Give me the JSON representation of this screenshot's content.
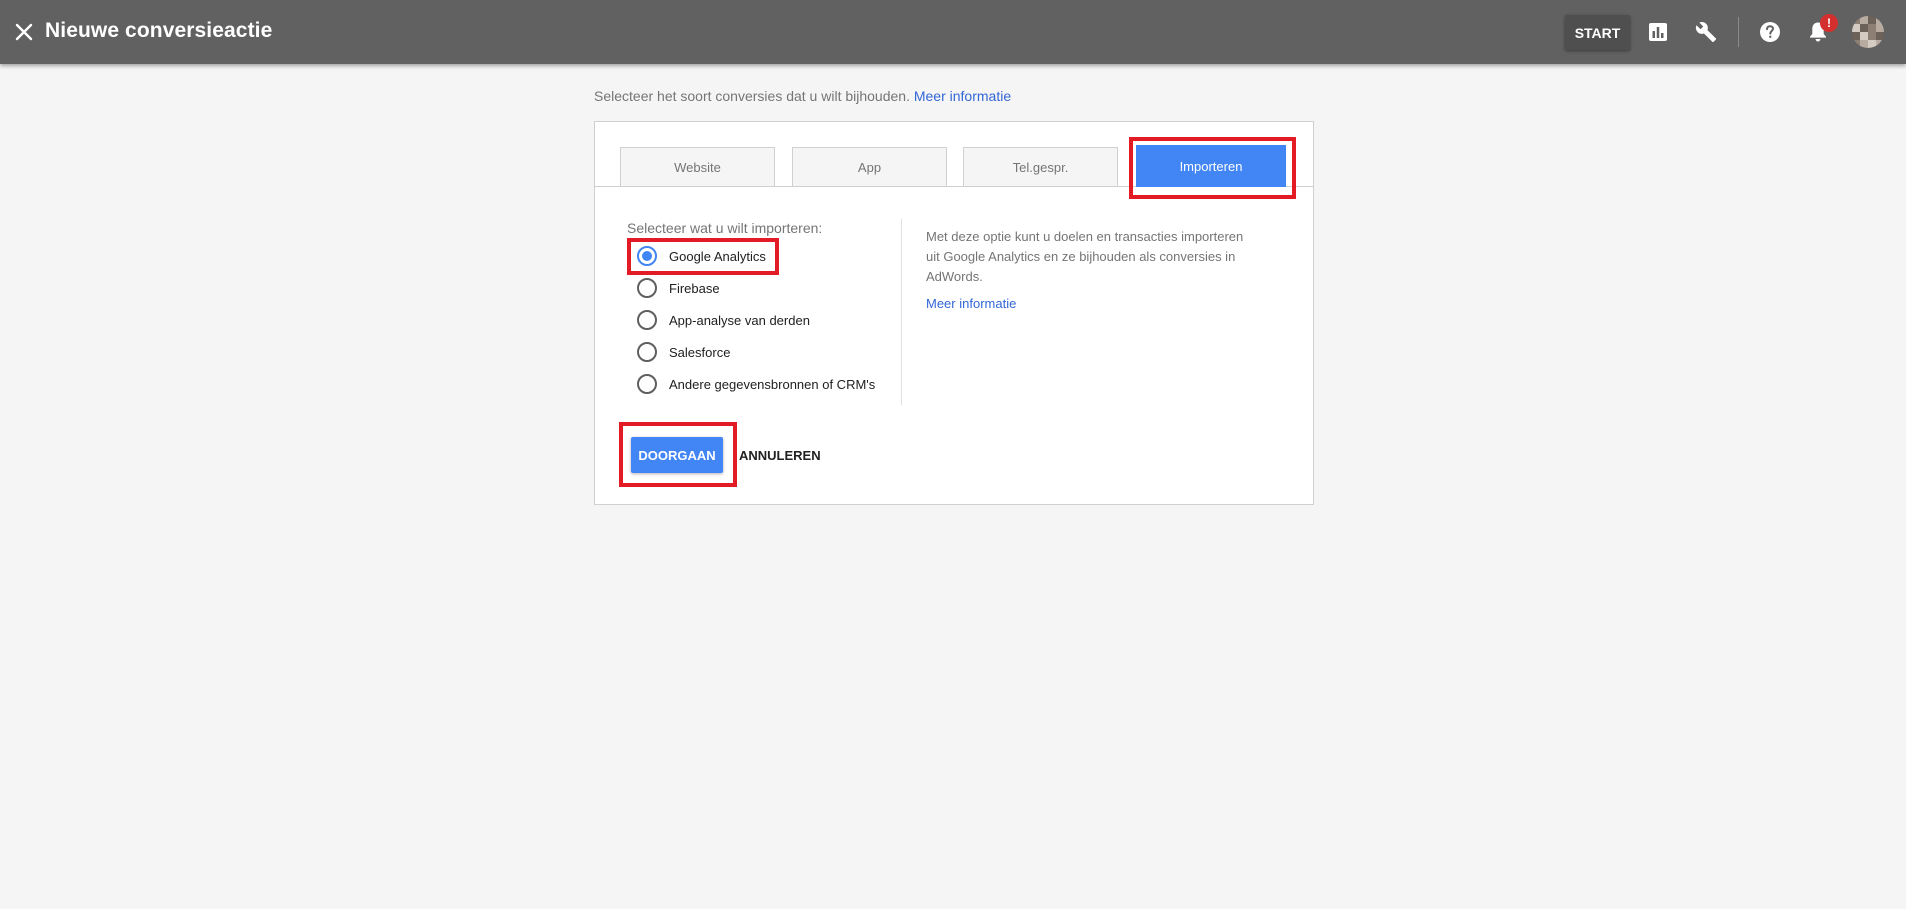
{
  "header": {
    "title": "Nieuwe conversieactie",
    "start_label": "START",
    "icons": [
      "close-icon",
      "bar-chart-icon",
      "wrench-icon",
      "help-icon",
      "bell-icon"
    ],
    "notification_badge": "!"
  },
  "intro": {
    "text": "Selecteer het soort conversies dat u wilt bijhouden.",
    "link": "Meer informatie"
  },
  "tabs": [
    {
      "label": "Website",
      "active": false
    },
    {
      "label": "App",
      "active": false
    },
    {
      "label": "Tel.gespr.",
      "active": false
    },
    {
      "label": "Importeren",
      "active": true
    }
  ],
  "import": {
    "label": "Selecteer wat u wilt importeren:",
    "options": [
      {
        "label": "Google Analytics",
        "checked": true
      },
      {
        "label": "Firebase",
        "checked": false
      },
      {
        "label": "App-analyse van derden",
        "checked": false
      },
      {
        "label": "Salesforce",
        "checked": false
      },
      {
        "label": "Andere gegevensbronnen of CRM's",
        "checked": false
      }
    ],
    "description": "Met deze optie kunt u doelen en transacties importeren uit Google Analytics en ze bijhouden als conversies in AdWords.",
    "description_link": "Meer informatie"
  },
  "actions": {
    "continue": "DOORGAAN",
    "cancel": "ANNULEREN"
  },
  "colors": {
    "topbar": "#616161",
    "accent": "#4285f4",
    "link": "#3367d6",
    "highlight": "#e21b24",
    "badge": "#d32f2f"
  }
}
